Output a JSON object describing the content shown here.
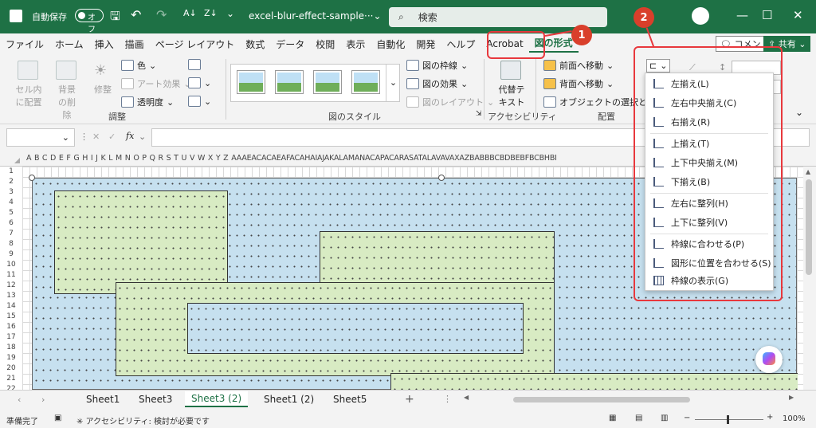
{
  "titlebar": {
    "autosave_label": "自動保存",
    "toggle_state": "オフ",
    "filename": "excel-blur-effect-sample···",
    "search_placeholder": "検索"
  },
  "menu": [
    "ファイル",
    "ホーム",
    "挿入",
    "描画",
    "ページ レイアウト",
    "数式",
    "データ",
    "校閲",
    "表示",
    "自動化",
    "開発",
    "ヘルプ",
    "Acrobat",
    "図の形式"
  ],
  "menu_active": "図の形式",
  "menu_right": {
    "comment": "コメント",
    "share": "共有"
  },
  "ribbon": {
    "remove_bg": "セル内に配置",
    "bg_remove": "背景の削除",
    "correct": "修整",
    "color": "色",
    "art_effect": "アート効果",
    "transparency": "透明度",
    "group_adjust": "調整",
    "group_style": "図のスタイル",
    "border": "図の枠線",
    "effect": "図の効果",
    "layout": "図のレイアウト",
    "alt_text": "代替テキスト",
    "group_access": "アクセシビリティ",
    "front": "前面へ移動",
    "back": "背面へ移動",
    "select": "オブジェクトの選択と表示",
    "group_arrange": "配置"
  },
  "formula": {
    "fx": "fx"
  },
  "columns": [
    "A",
    "B",
    "C",
    "D",
    "E",
    "F",
    "G",
    "H",
    "I",
    "J",
    "K",
    "L",
    "M",
    "N",
    "O",
    "P",
    "Q",
    "R",
    "S",
    "T",
    "U",
    "V",
    "W",
    "X",
    "Y",
    "Z",
    "AAAEACACAEAFACAHAIAJAKALAMANACAPACARASATALAVAVAXAZBABBBCBDBEBFBCBHBI"
  ],
  "rows": [
    "1",
    "2",
    "3",
    "4",
    "5",
    "6",
    "7",
    "8",
    "9",
    "10",
    "11",
    "12",
    "13",
    "14",
    "15",
    "16",
    "17",
    "18",
    "19",
    "20",
    "21",
    "22"
  ],
  "align_menu": [
    "左揃え(L)",
    "左右中央揃え(C)",
    "右揃え(R)",
    "上揃え(T)",
    "上下中央揃え(M)",
    "下揃え(B)",
    "左右に整列(H)",
    "上下に整列(V)",
    "枠線に合わせる(P)",
    "図形に位置を合わせる(S)",
    "枠線の表示(G)"
  ],
  "badges": [
    "1",
    "2"
  ],
  "sheets": [
    "Sheet1",
    "Sheet3",
    "Sheet3 (2)",
    "Sheet1 (2)",
    "Sheet5"
  ],
  "active_sheet_index": 2,
  "status": {
    "ready": "準備完了",
    "accessibility": "アクセシビリティ: 検討が必要です",
    "zoom": "100%"
  }
}
